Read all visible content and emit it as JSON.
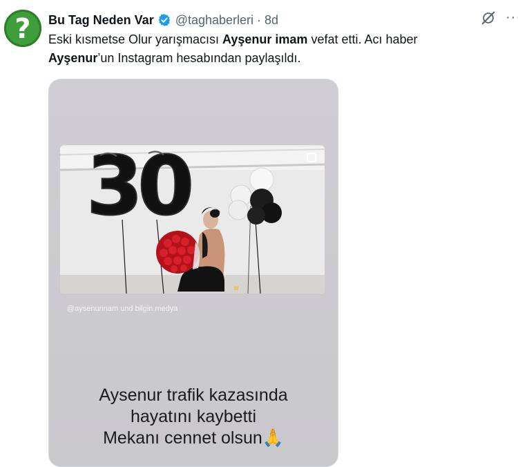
{
  "tweet": {
    "author_name": "Bu Tag Neden Var",
    "handle": "@taghaberleri",
    "separator": "·",
    "age": "8d",
    "more": "···",
    "text_p1": "Eski kısmetse Olur yarışmacısı ",
    "text_b1": "Ayşenur imam",
    "text_p2": " vefat etti. Acı haber",
    "text_b2": "Ayşenur",
    "text_p3": "’un Instagram hesabından paylaşıldı."
  },
  "icons": {
    "avatar": "question-mark-avatar",
    "verified": "verified-badge-icon",
    "grok": "grok-icon",
    "more": "more-options-icon"
  },
  "media": {
    "tag_line": "@aysenurinam und bilgin.medya",
    "balloon_digits": "30",
    "caption_line1": "Aysenur trafik kazasında",
    "caption_line2": "hayatını kaybetti",
    "caption_line3": "Mekanı cennet olsun🙏"
  },
  "colors": {
    "brand_avatar": "#3f9e3c",
    "verified_blue": "#1d9bf0",
    "text": "#0f1419",
    "muted": "#536471"
  }
}
